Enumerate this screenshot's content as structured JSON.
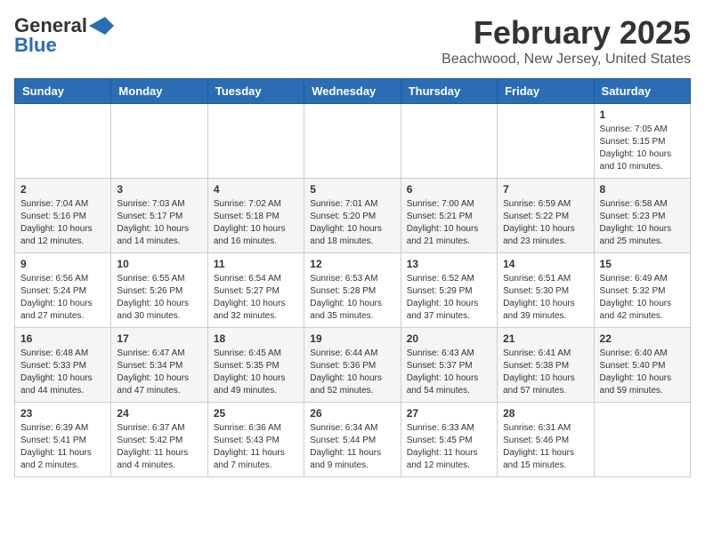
{
  "header": {
    "logo_line1": "General",
    "logo_line2": "Blue",
    "month_title": "February 2025",
    "location": "Beachwood, New Jersey, United States"
  },
  "weekdays": [
    "Sunday",
    "Monday",
    "Tuesday",
    "Wednesday",
    "Thursday",
    "Friday",
    "Saturday"
  ],
  "weeks": [
    [
      {
        "day": "",
        "info": ""
      },
      {
        "day": "",
        "info": ""
      },
      {
        "day": "",
        "info": ""
      },
      {
        "day": "",
        "info": ""
      },
      {
        "day": "",
        "info": ""
      },
      {
        "day": "",
        "info": ""
      },
      {
        "day": "1",
        "info": "Sunrise: 7:05 AM\nSunset: 5:15 PM\nDaylight: 10 hours and 10 minutes."
      }
    ],
    [
      {
        "day": "2",
        "info": "Sunrise: 7:04 AM\nSunset: 5:16 PM\nDaylight: 10 hours and 12 minutes."
      },
      {
        "day": "3",
        "info": "Sunrise: 7:03 AM\nSunset: 5:17 PM\nDaylight: 10 hours and 14 minutes."
      },
      {
        "day": "4",
        "info": "Sunrise: 7:02 AM\nSunset: 5:18 PM\nDaylight: 10 hours and 16 minutes."
      },
      {
        "day": "5",
        "info": "Sunrise: 7:01 AM\nSunset: 5:20 PM\nDaylight: 10 hours and 18 minutes."
      },
      {
        "day": "6",
        "info": "Sunrise: 7:00 AM\nSunset: 5:21 PM\nDaylight: 10 hours and 21 minutes."
      },
      {
        "day": "7",
        "info": "Sunrise: 6:59 AM\nSunset: 5:22 PM\nDaylight: 10 hours and 23 minutes."
      },
      {
        "day": "8",
        "info": "Sunrise: 6:58 AM\nSunset: 5:23 PM\nDaylight: 10 hours and 25 minutes."
      }
    ],
    [
      {
        "day": "9",
        "info": "Sunrise: 6:56 AM\nSunset: 5:24 PM\nDaylight: 10 hours and 27 minutes."
      },
      {
        "day": "10",
        "info": "Sunrise: 6:55 AM\nSunset: 5:26 PM\nDaylight: 10 hours and 30 minutes."
      },
      {
        "day": "11",
        "info": "Sunrise: 6:54 AM\nSunset: 5:27 PM\nDaylight: 10 hours and 32 minutes."
      },
      {
        "day": "12",
        "info": "Sunrise: 6:53 AM\nSunset: 5:28 PM\nDaylight: 10 hours and 35 minutes."
      },
      {
        "day": "13",
        "info": "Sunrise: 6:52 AM\nSunset: 5:29 PM\nDaylight: 10 hours and 37 minutes."
      },
      {
        "day": "14",
        "info": "Sunrise: 6:51 AM\nSunset: 5:30 PM\nDaylight: 10 hours and 39 minutes."
      },
      {
        "day": "15",
        "info": "Sunrise: 6:49 AM\nSunset: 5:32 PM\nDaylight: 10 hours and 42 minutes."
      }
    ],
    [
      {
        "day": "16",
        "info": "Sunrise: 6:48 AM\nSunset: 5:33 PM\nDaylight: 10 hours and 44 minutes."
      },
      {
        "day": "17",
        "info": "Sunrise: 6:47 AM\nSunset: 5:34 PM\nDaylight: 10 hours and 47 minutes."
      },
      {
        "day": "18",
        "info": "Sunrise: 6:45 AM\nSunset: 5:35 PM\nDaylight: 10 hours and 49 minutes."
      },
      {
        "day": "19",
        "info": "Sunrise: 6:44 AM\nSunset: 5:36 PM\nDaylight: 10 hours and 52 minutes."
      },
      {
        "day": "20",
        "info": "Sunrise: 6:43 AM\nSunset: 5:37 PM\nDaylight: 10 hours and 54 minutes."
      },
      {
        "day": "21",
        "info": "Sunrise: 6:41 AM\nSunset: 5:38 PM\nDaylight: 10 hours and 57 minutes."
      },
      {
        "day": "22",
        "info": "Sunrise: 6:40 AM\nSunset: 5:40 PM\nDaylight: 10 hours and 59 minutes."
      }
    ],
    [
      {
        "day": "23",
        "info": "Sunrise: 6:39 AM\nSunset: 5:41 PM\nDaylight: 11 hours and 2 minutes."
      },
      {
        "day": "24",
        "info": "Sunrise: 6:37 AM\nSunset: 5:42 PM\nDaylight: 11 hours and 4 minutes."
      },
      {
        "day": "25",
        "info": "Sunrise: 6:36 AM\nSunset: 5:43 PM\nDaylight: 11 hours and 7 minutes."
      },
      {
        "day": "26",
        "info": "Sunrise: 6:34 AM\nSunset: 5:44 PM\nDaylight: 11 hours and 9 minutes."
      },
      {
        "day": "27",
        "info": "Sunrise: 6:33 AM\nSunset: 5:45 PM\nDaylight: 11 hours and 12 minutes."
      },
      {
        "day": "28",
        "info": "Sunrise: 6:31 AM\nSunset: 5:46 PM\nDaylight: 11 hours and 15 minutes."
      },
      {
        "day": "",
        "info": ""
      }
    ]
  ]
}
